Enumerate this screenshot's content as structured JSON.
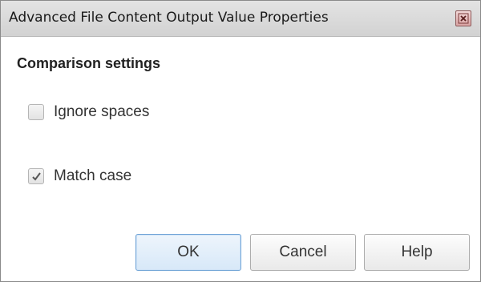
{
  "window": {
    "title": "Advanced File Content Output Value Properties",
    "close_icon": "close-icon"
  },
  "section": {
    "heading": "Comparison settings"
  },
  "options": [
    {
      "label": "Ignore spaces",
      "checked": false
    },
    {
      "label": "Match case",
      "checked": true
    }
  ],
  "buttons": {
    "ok": "OK",
    "cancel": "Cancel",
    "help": "Help"
  },
  "colors": {
    "default_button_border": "#6fa3d6",
    "close_button": "#d9a3a3"
  }
}
